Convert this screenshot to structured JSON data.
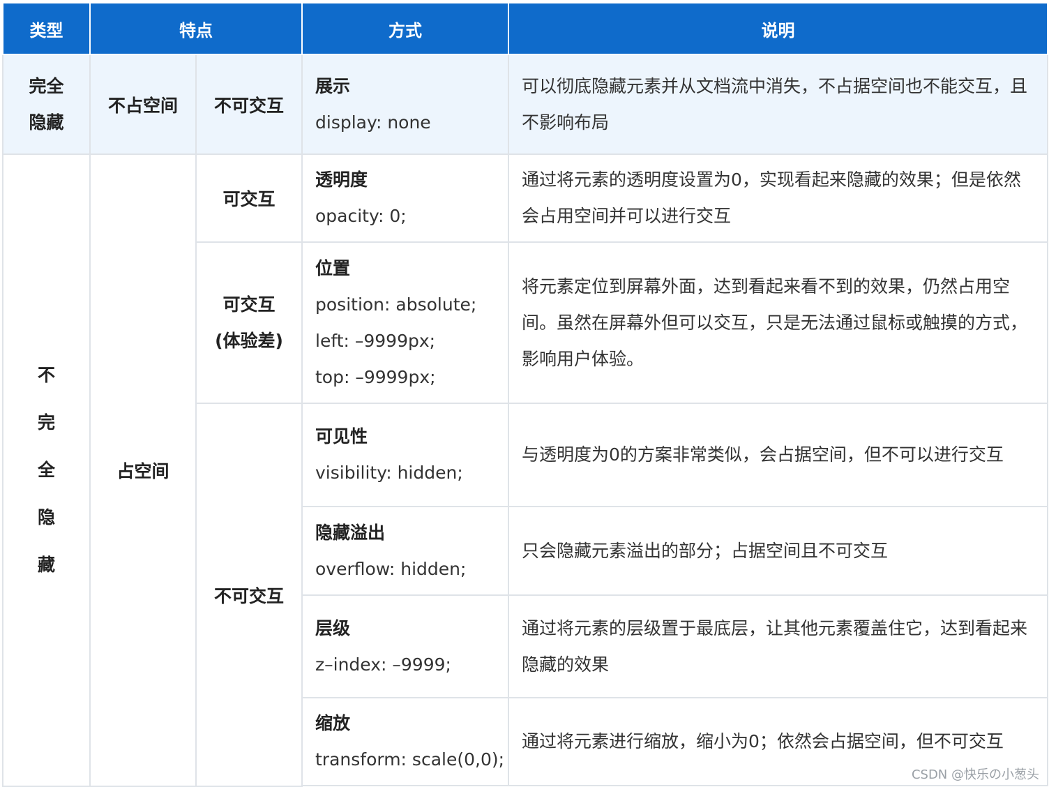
{
  "header": {
    "type": "类型",
    "feature": "特点",
    "method": "方式",
    "description": "说明"
  },
  "rows": {
    "full": {
      "category": [
        "完全",
        "隐藏"
      ],
      "space": "不占空间",
      "interact": "不可交互",
      "method_title": "展示",
      "code": [
        "display: none"
      ],
      "desc": "可以彻底隐藏元素并从文档流中消失，不占据空间也不能交互，且不影响布局"
    },
    "partial": {
      "category": [
        "不",
        "完",
        "全",
        "隐",
        "藏"
      ],
      "space": "占空间",
      "opacity": {
        "interact": "可交互",
        "method_title": "透明度",
        "code": [
          "opacity: 0;"
        ],
        "desc": "通过将元素的透明度设置为0，实现看起来隐藏的效果；但是依然会占用空间并可以进行交互"
      },
      "position": {
        "interact": [
          "可交互",
          "(体验差)"
        ],
        "method_title": "位置",
        "code": [
          "position: absolute;",
          "left: –9999px;",
          "top: –9999px;"
        ],
        "desc": "将元素定位到屏幕外面，达到看起来看不到的效果，仍然占用空间。虽然在屏幕外但可以交互，只是无法通过鼠标或触摸的方式，影响用户体验。"
      },
      "non_interact": "不可交互",
      "visibility": {
        "method_title": "可见性",
        "code": [
          "visibility: hidden;"
        ],
        "desc": "与透明度为0的方案非常类似，会占据空间，但不可以进行交互"
      },
      "overflow": {
        "method_title": "隐藏溢出",
        "code": [
          "overflow: hidden;"
        ],
        "desc": "只会隐藏元素溢出的部分；占据空间且不可交互"
      },
      "zindex": {
        "method_title": "层级",
        "code": [
          "z–index: –9999;"
        ],
        "desc": "通过将元素的层级置于最底层，让其他元素覆盖住它，达到看起来隐藏的效果"
      },
      "scale": {
        "method_title": "缩放",
        "code": [
          "transform: scale(0,0);"
        ],
        "desc": "通过将元素进行缩放，缩小为0；依然会占据空间，但不可交互"
      }
    }
  },
  "watermark": "CSDN @快乐の小葱头"
}
